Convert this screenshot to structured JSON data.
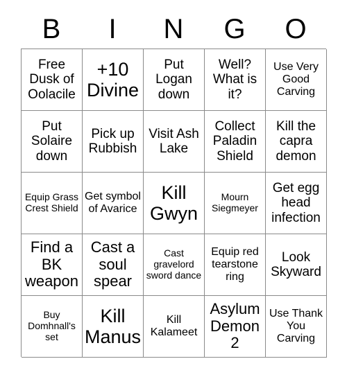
{
  "card": {
    "title": "BINGO",
    "header_letters": [
      "B",
      "I",
      "N",
      "G",
      "O"
    ],
    "grid_size": "5x5",
    "colors": {
      "background": "#ffffff",
      "text": "#000000",
      "grid_line": "#8a8a8a"
    }
  },
  "cells": [
    {
      "text": "Free Dusk of Oolacile",
      "size": "s-md",
      "column": "B",
      "row": 1
    },
    {
      "text": "+10 Divine",
      "size": "s-xl",
      "column": "I",
      "row": 1
    },
    {
      "text": "Put Logan down",
      "size": "s-md",
      "column": "N",
      "row": 1
    },
    {
      "text": "Well? What is it?",
      "size": "s-md",
      "column": "G",
      "row": 1
    },
    {
      "text": "Use Very Good Carving",
      "size": "s-sm",
      "column": "O",
      "row": 1
    },
    {
      "text": "Put Solaire down",
      "size": "s-md",
      "column": "B",
      "row": 2
    },
    {
      "text": "Pick up Rubbish",
      "size": "s-md",
      "column": "I",
      "row": 2
    },
    {
      "text": "Visit Ash Lake",
      "size": "s-md",
      "column": "N",
      "row": 2
    },
    {
      "text": "Collect Paladin Shield",
      "size": "s-md",
      "column": "G",
      "row": 2
    },
    {
      "text": "Kill the capra demon",
      "size": "s-md",
      "column": "O",
      "row": 2
    },
    {
      "text": "Equip Grass Crest Shield",
      "size": "s-xs",
      "column": "B",
      "row": 3
    },
    {
      "text": "Get symbol of Avarice",
      "size": "s-sm",
      "column": "I",
      "row": 3
    },
    {
      "text": "Kill Gwyn",
      "size": "s-xl",
      "column": "N",
      "row": 3
    },
    {
      "text": "Mourn Siegmeyer",
      "size": "s-xs",
      "column": "G",
      "row": 3
    },
    {
      "text": "Get egg head infection",
      "size": "s-md",
      "column": "O",
      "row": 3
    },
    {
      "text": "Find a BK weapon",
      "size": "s-lg",
      "column": "B",
      "row": 4
    },
    {
      "text": "Cast a soul spear",
      "size": "s-lg",
      "column": "I",
      "row": 4
    },
    {
      "text": "Cast gravelord sword dance",
      "size": "s-xs",
      "column": "N",
      "row": 4
    },
    {
      "text": "Equip red tearstone ring",
      "size": "s-sm",
      "column": "G",
      "row": 4
    },
    {
      "text": "Look Skyward",
      "size": "s-md",
      "column": "O",
      "row": 4
    },
    {
      "text": "Buy Domhnall's set",
      "size": "s-xs",
      "column": "B",
      "row": 5
    },
    {
      "text": "Kill Manus",
      "size": "s-xl",
      "column": "I",
      "row": 5
    },
    {
      "text": "Kill Kalameet",
      "size": "s-sm",
      "column": "N",
      "row": 5
    },
    {
      "text": "Asylum Demon 2",
      "size": "s-lg",
      "column": "G",
      "row": 5
    },
    {
      "text": "Use Thank You Carving",
      "size": "s-sm",
      "column": "O",
      "row": 5
    }
  ]
}
